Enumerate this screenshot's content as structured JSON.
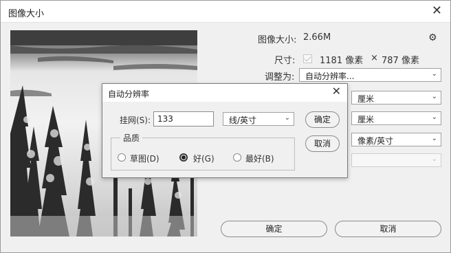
{
  "window": {
    "title": "图像大小"
  },
  "info": {
    "size_label": "图像大小:",
    "size_value": "2.66M",
    "dims_label": "尺寸:",
    "width_value": "1181 像素",
    "times": "×",
    "height_value": "787 像素",
    "fit_label": "调整为:",
    "fit_value": "自动分辨率..."
  },
  "units": {
    "width_unit": "厘米",
    "height_unit": "厘米",
    "resolution_unit": "像素/英寸"
  },
  "buttons": {
    "ok": "确定",
    "cancel": "取消"
  },
  "auto_dialog": {
    "title": "自动分辨率",
    "screen_label": "挂网(S):",
    "screen_value": "133",
    "screen_unit": "线/英寸",
    "ok": "确定",
    "cancel": "取消",
    "quality_label": "品质",
    "quality_options": [
      {
        "label": "草图(D)",
        "selected": false
      },
      {
        "label": "好(G)",
        "selected": true
      },
      {
        "label": "最好(B)",
        "selected": false
      }
    ]
  },
  "icons": [
    "close-icon",
    "gear-icon",
    "checkbox-icon",
    "chevron-down-icon"
  ]
}
